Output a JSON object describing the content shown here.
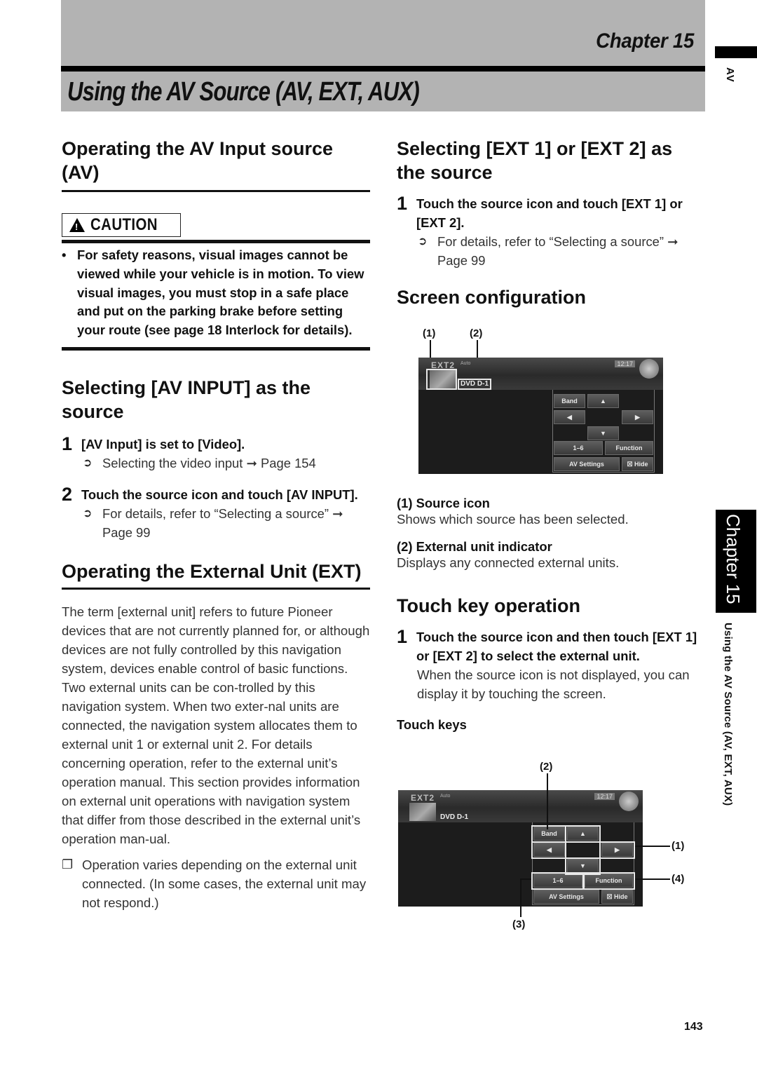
{
  "header": {
    "chapter": "Chapter 15",
    "title": "Using the AV Source (AV, EXT, AUX)"
  },
  "side_tab": {
    "section": "AV",
    "chapter": "Chapter 15",
    "running_title": "Using the AV Source (AV, EXT, AUX)"
  },
  "left": {
    "sec1": {
      "heading": "Operating the AV Input source (AV)",
      "caution_label": "CAUTION",
      "caution_text": "For safety reasons, visual images cannot be viewed while your vehicle is in motion. To view visual images, you must stop in a safe place and put on the parking brake before setting your route (see page 18 Interlock for details)."
    },
    "sec2": {
      "heading": "Selecting [AV INPUT] as the source",
      "steps": [
        {
          "num": "1",
          "text": "[AV Input] is set to [Video].",
          "ref": "Selecting the video input ➞ Page 154"
        },
        {
          "num": "2",
          "text": "Touch the source icon and touch [AV INPUT].",
          "ref": "For details, refer to “Selecting a source” ➞ Page 99"
        }
      ]
    },
    "sec3": {
      "heading": "Operating the External Unit (EXT)",
      "body": "The term [external unit] refers to future Pioneer devices that are not currently planned for, or although devices are not fully controlled by this navigation system, devices enable control of basic functions. Two external units can be con-trolled by this navigation system. When two exter-nal units are connected, the navigation system allocates them to external unit 1 or external unit 2. For details concerning operation, refer to the external unit’s operation manual. This section provides information on external unit operations with navigation system that differ from those described in the external unit’s operation man-ual.",
      "note": "Operation varies depending on the external unit connected. (In some cases, the external unit may not respond.)"
    }
  },
  "right": {
    "sec1": {
      "heading": "Selecting [EXT 1] or [EXT 2] as the source",
      "step": {
        "num": "1",
        "text": "Touch the source icon and touch [EXT 1] or [EXT 2].",
        "ref": "For details, refer to “Selecting a source” ➞ Page 99"
      }
    },
    "sec2": {
      "heading": "Screen configuration",
      "callouts": [
        "(1)",
        "(2)"
      ],
      "items": [
        {
          "label": "(1) Source icon",
          "desc": "Shows which source has been selected."
        },
        {
          "label": "(2) External unit indicator",
          "desc": "Displays any connected external units."
        }
      ]
    },
    "sec3": {
      "heading": "Touch key operation",
      "step": {
        "num": "1",
        "text": "Touch the source icon and then touch [EXT 1] or [EXT 2] to select the external unit.",
        "desc": "When the source icon is not displayed, you can display it by touching the screen."
      },
      "subheading": "Touch keys",
      "callouts": [
        "(2)",
        "(1)",
        "(4)",
        "(3)"
      ]
    }
  },
  "screen": {
    "source": "EXT2",
    "source_sub": "Auto",
    "clock": "12:17",
    "indicator": "DVD D-1",
    "keys": {
      "band": "Band",
      "up": "▲",
      "left": "◀",
      "right": "▶",
      "down": "▼",
      "preset": "1–6",
      "function": "Function",
      "av_settings": "AV Settings",
      "hide": "☒ Hide"
    }
  },
  "footer": {
    "page_number": "143"
  }
}
